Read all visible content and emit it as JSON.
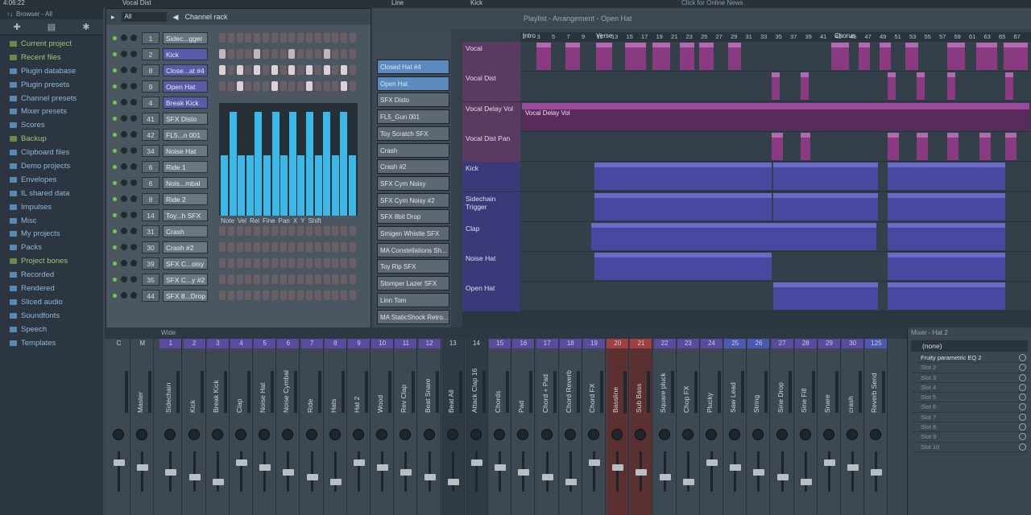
{
  "topbar": {
    "time": "4:06:22",
    "hint": "Vocal Dist",
    "line_label": "Line",
    "kick_label": "Kick",
    "news": "Click for Online News"
  },
  "browser": {
    "label": "Browser - All",
    "items": [
      {
        "label": "Current project",
        "kind": "green"
      },
      {
        "label": "Recent files",
        "kind": "green"
      },
      {
        "label": "Plugin database",
        "kind": "cyan"
      },
      {
        "label": "Plugin presets",
        "kind": "cyan"
      },
      {
        "label": "Channel presets",
        "kind": "cyan"
      },
      {
        "label": "Mixer presets",
        "kind": "cyan"
      },
      {
        "label": "Scores",
        "kind": "cyan"
      },
      {
        "label": "Backup",
        "kind": "green"
      },
      {
        "label": "Clipboard files",
        "kind": "cyan"
      },
      {
        "label": "Demo projects",
        "kind": "cyan"
      },
      {
        "label": "Envelopes",
        "kind": "cyan"
      },
      {
        "label": "IL shared data",
        "kind": "cyan"
      },
      {
        "label": "Impulses",
        "kind": "cyan"
      },
      {
        "label": "Misc",
        "kind": "cyan"
      },
      {
        "label": "My projects",
        "kind": "cyan"
      },
      {
        "label": "Packs",
        "kind": "cyan"
      },
      {
        "label": "Project bones",
        "kind": "green"
      },
      {
        "label": "Recorded",
        "kind": "cyan"
      },
      {
        "label": "Rendered",
        "kind": "cyan"
      },
      {
        "label": "Sliced audio",
        "kind": "cyan"
      },
      {
        "label": "Soundfonts",
        "kind": "cyan"
      },
      {
        "label": "Speech",
        "kind": "cyan"
      },
      {
        "label": "Templates",
        "kind": "cyan"
      }
    ]
  },
  "rack": {
    "title": "Channel rack",
    "filter": "All",
    "channels": [
      {
        "num": "1",
        "name": "Sidec...gger",
        "hl": false
      },
      {
        "num": "2",
        "name": "Kick",
        "hl": true
      },
      {
        "num": "8",
        "name": "Close...at #4",
        "hl": true
      },
      {
        "num": "9",
        "name": "Open Hat",
        "hl": true
      },
      {
        "num": "4",
        "name": "Break Kick",
        "hl": true
      },
      {
        "num": "41",
        "name": "SFX Disto",
        "hl": false
      },
      {
        "num": "42",
        "name": "FL5...n 001",
        "hl": false
      },
      {
        "num": "34",
        "name": "Noise Hat",
        "hl": false
      },
      {
        "num": "6",
        "name": "Ride 1",
        "hl": false
      },
      {
        "num": "6",
        "name": "Nois...mbal",
        "hl": false
      },
      {
        "num": "8",
        "name": "Ride 2",
        "hl": false
      },
      {
        "num": "14",
        "name": "Toy...h SFX",
        "hl": false
      },
      {
        "num": "31",
        "name": "Crash",
        "hl": false
      },
      {
        "num": "30",
        "name": "Crash #2",
        "hl": false
      },
      {
        "num": "39",
        "name": "SFX C...oisy",
        "hl": false
      },
      {
        "num": "35",
        "name": "SFX C...y #2",
        "hl": false
      },
      {
        "num": "44",
        "name": "SFX 8...Drop",
        "hl": false
      }
    ],
    "graph_tabs": [
      "Note",
      "Vel",
      "Rel",
      "Fine",
      "Pan",
      "X",
      "Y",
      "Shift"
    ],
    "graph_values": [
      0.55,
      0.95,
      0.55,
      0.55,
      0.95,
      0.55,
      0.95,
      0.55,
      0.95,
      0.55,
      0.95,
      0.55,
      0.95,
      0.55,
      0.95,
      0.55
    ]
  },
  "playlist": {
    "path": "Playlist - Arrangement - Open Hat",
    "markers": [
      "Intro",
      "Verse",
      "Chorus"
    ],
    "ruler": [
      "1",
      "3",
      "5",
      "7",
      "9",
      "11",
      "13",
      "15",
      "17",
      "19",
      "21",
      "23",
      "25",
      "27",
      "29",
      "31",
      "33",
      "35",
      "37",
      "39",
      "41",
      "43",
      "45",
      "47",
      "49",
      "51",
      "53",
      "55",
      "57",
      "59",
      "61",
      "63",
      "65",
      "67"
    ],
    "patterns": [
      "Closed Hat #4",
      "Open Hat",
      "SFX Disto",
      "FL5_Gun 001",
      "Toy Scratch SFX",
      "Crash",
      "Crash #2",
      "SFX Cym Noisy",
      "SFX Cym Noisy #2",
      "SFX 8bit Drop",
      "Smigen Whistle SFX",
      "MA Constellations Sh...",
      "Toy Rip SFX",
      "Stomper Lazer SFX",
      "Linn Tom",
      "MA StaticShock Retro..."
    ],
    "tracks": [
      {
        "label": "Vocal",
        "color": "purple"
      },
      {
        "label": "Vocal Dist",
        "color": "purple"
      },
      {
        "label": "Vocal Delay Vol",
        "color": "purple"
      },
      {
        "label": "Vocal Dist Pan",
        "color": "purple"
      },
      {
        "label": "Kick",
        "color": "blue"
      },
      {
        "label": "Sidechain Trigger",
        "color": "blue"
      },
      {
        "label": "Clap",
        "color": "blue"
      },
      {
        "label": "Noise Hat",
        "color": "blue"
      },
      {
        "label": "Open Hat",
        "color": "blue"
      }
    ],
    "automation_label": "Vocal Delay Vol"
  },
  "mixer": {
    "label": "Wide",
    "strips": [
      {
        "num": "C",
        "name": "",
        "color": "#3c4852"
      },
      {
        "num": "M",
        "name": "Master",
        "color": "#3c4852"
      },
      {
        "num": "1",
        "name": "Sidechain",
        "color": "#5a4aa0"
      },
      {
        "num": "2",
        "name": "Kick",
        "color": "#5a4aa0"
      },
      {
        "num": "3",
        "name": "Break Kick",
        "color": "#5a4aa0"
      },
      {
        "num": "4",
        "name": "Clap",
        "color": "#5a4aa0"
      },
      {
        "num": "5",
        "name": "Noise Hat",
        "color": "#5a4aa0"
      },
      {
        "num": "6",
        "name": "Noise Cymbal",
        "color": "#5a4aa0"
      },
      {
        "num": "7",
        "name": "Ride",
        "color": "#5a4aa0"
      },
      {
        "num": "8",
        "name": "Hats",
        "color": "#5a4aa0"
      },
      {
        "num": "9",
        "name": "Hat 2",
        "color": "#5a4aa0"
      },
      {
        "num": "10",
        "name": "Wood",
        "color": "#5a4aa0"
      },
      {
        "num": "11",
        "name": "Rev Clap",
        "color": "#5a4aa0"
      },
      {
        "num": "12",
        "name": "Beat Snare",
        "color": "#5a4aa0"
      },
      {
        "num": "13",
        "name": "Beat All",
        "color": "#2e3a44"
      },
      {
        "num": "14",
        "name": "Attack Clap 16",
        "color": "#2e3a44"
      },
      {
        "num": "15",
        "name": "Chords",
        "color": "#5a4aa0"
      },
      {
        "num": "16",
        "name": "Pad",
        "color": "#5a4aa0"
      },
      {
        "num": "17",
        "name": "Chord + Pad",
        "color": "#5a4aa0"
      },
      {
        "num": "18",
        "name": "Chord Reverb",
        "color": "#5a4aa0"
      },
      {
        "num": "19",
        "name": "Chord FX",
        "color": "#5a4aa0"
      },
      {
        "num": "20",
        "name": "Bassline",
        "color": "#a04040"
      },
      {
        "num": "21",
        "name": "Sub Bass",
        "color": "#a04040"
      },
      {
        "num": "22",
        "name": "Square pluck",
        "color": "#5a4aa0"
      },
      {
        "num": "23",
        "name": "Chop FX",
        "color": "#5a4aa0"
      },
      {
        "num": "24",
        "name": "Plucky",
        "color": "#5a4aa0"
      },
      {
        "num": "25",
        "name": "Saw Lead",
        "color": "#4a5ab0"
      },
      {
        "num": "26",
        "name": "String",
        "color": "#4a5ab0"
      },
      {
        "num": "27",
        "name": "Sine Drop",
        "color": "#5a4aa0"
      },
      {
        "num": "28",
        "name": "Sine Fill",
        "color": "#5a4aa0"
      },
      {
        "num": "29",
        "name": "Snare",
        "color": "#5a4aa0"
      },
      {
        "num": "30",
        "name": "crash",
        "color": "#5a4aa0"
      },
      {
        "num": "125",
        "name": "Reverb Send",
        "color": "#4a5ab0"
      }
    ]
  },
  "fx": {
    "title": "Mixer - Hat 2",
    "preset": "(none)",
    "slots": [
      "Fruity parametric EQ 2",
      "Slot 2",
      "Slot 3",
      "Slot 4",
      "Slot 5",
      "Slot 6",
      "Slot 7",
      "Slot 8",
      "Slot 9",
      "Slot 10"
    ]
  }
}
